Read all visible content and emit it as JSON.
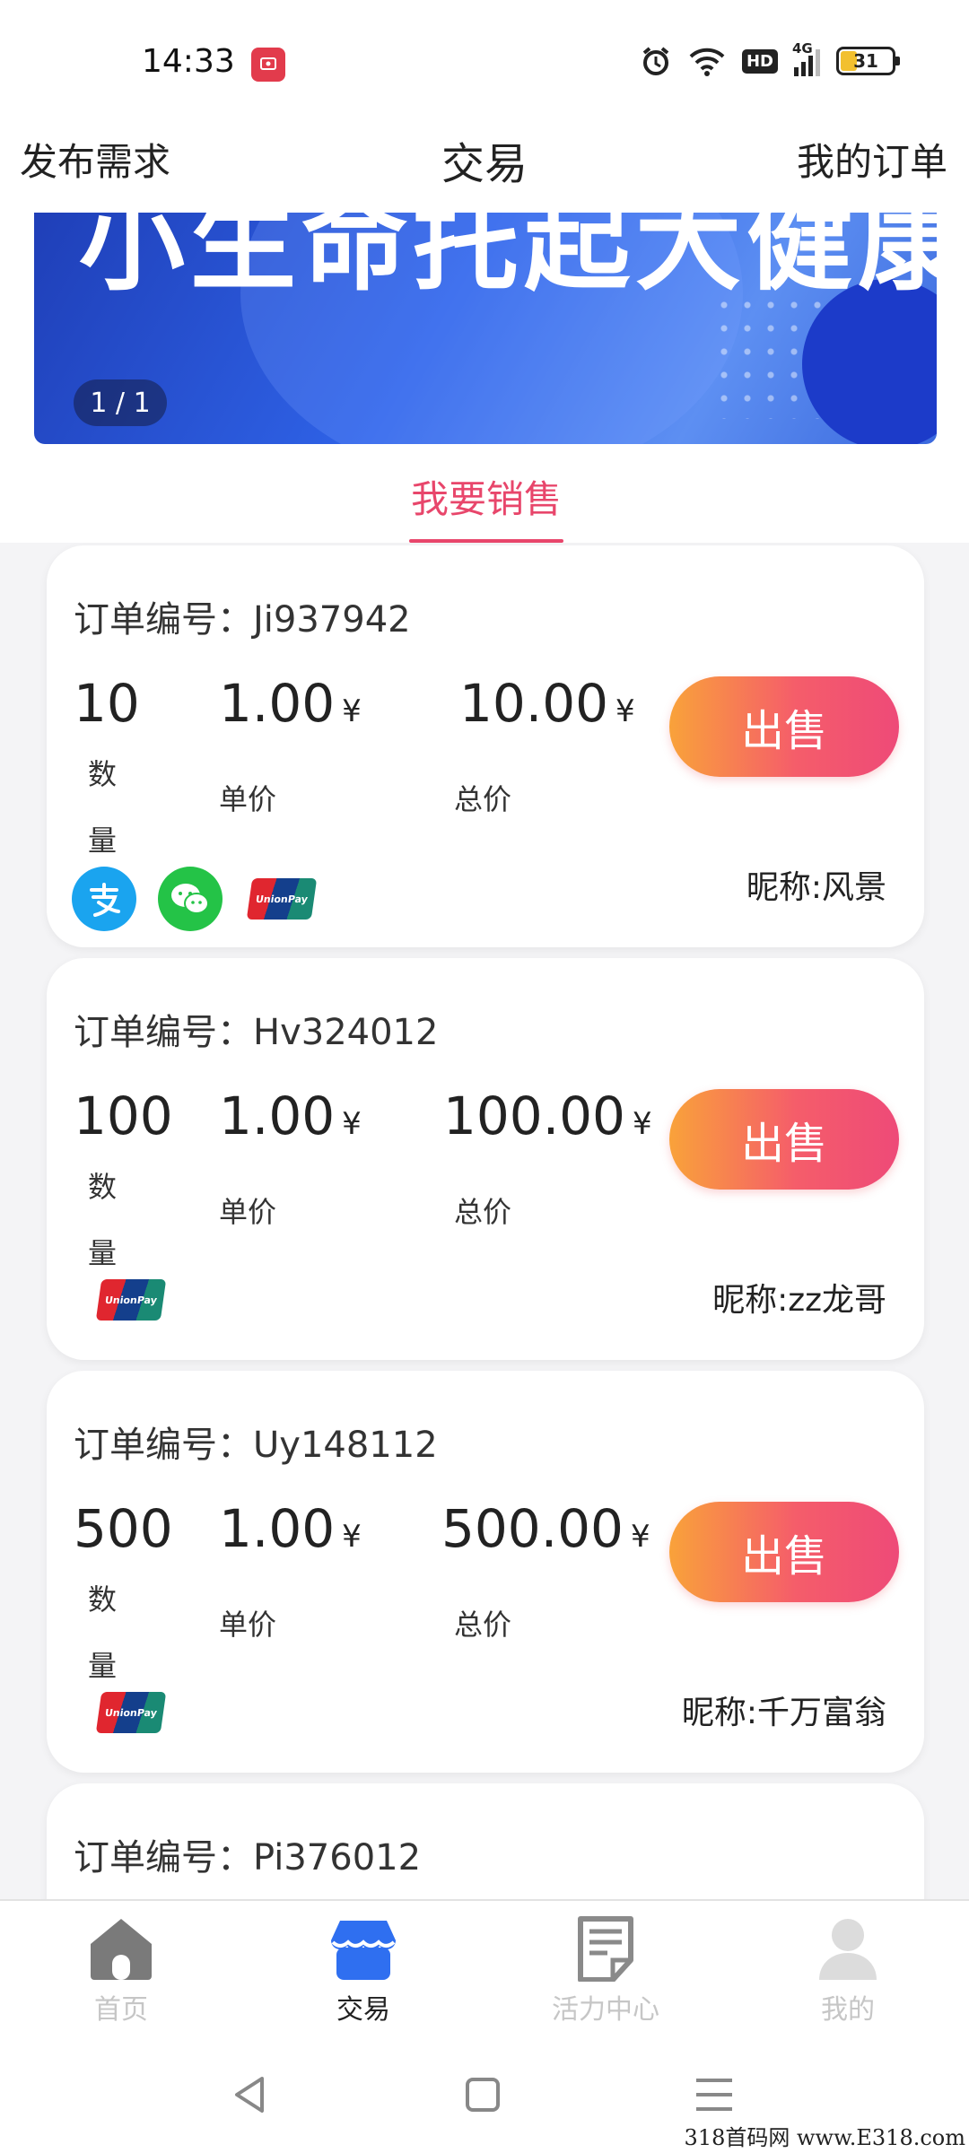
{
  "status_bar": {
    "time": "14:33",
    "battery": "31",
    "network": "4G",
    "hd_label": "HD"
  },
  "header": {
    "left": "发布需求",
    "title": "交易",
    "right": "我的订单"
  },
  "banner": {
    "text": "小生命托起大健康",
    "pager": "1 / 1"
  },
  "tabs": {
    "sell": "我要销售"
  },
  "orders": [
    {
      "order_label": "订单编号：Ji937942",
      "quantity": "10",
      "quantity_label": "数量",
      "unit_price": "1.00",
      "unit_price_label": "单价",
      "total": "10.00",
      "total_label": "总价",
      "currency": "¥",
      "button": "出售",
      "nickname": "昵称:风景",
      "payment_methods": [
        "alipay-icon",
        "wechat-pay-icon",
        "unionpay-icon"
      ]
    },
    {
      "order_label": "订单编号：Hv324012",
      "quantity": "100",
      "quantity_label": "数量",
      "unit_price": "1.00",
      "unit_price_label": "单价",
      "total": "100.00",
      "total_label": "总价",
      "currency": "¥",
      "button": "出售",
      "nickname": "昵称:zz龙哥",
      "payment_methods": [
        "unionpay-icon"
      ]
    },
    {
      "order_label": "订单编号：Uy148112",
      "quantity": "500",
      "quantity_label": "数量",
      "unit_price": "1.00",
      "unit_price_label": "单价",
      "total": "500.00",
      "total_label": "总价",
      "currency": "¥",
      "button": "出售",
      "nickname": "昵称:千万富翁",
      "payment_methods": [
        "unionpay-icon"
      ]
    },
    {
      "order_label": "订单编号：Pi376012"
    }
  ],
  "bottom_nav": [
    {
      "label": "首页",
      "icon": "home-icon",
      "active": false
    },
    {
      "label": "交易",
      "icon": "shop-icon",
      "active": true
    },
    {
      "label": "活力中心",
      "icon": "document-icon",
      "active": false
    },
    {
      "label": "我的",
      "icon": "profile-icon",
      "active": false
    }
  ],
  "watermark": "318首码网  www.E318.com",
  "colors": {
    "accent": "#e8466b",
    "button_gradient_start": "#f9a23a",
    "button_gradient_end": "#ee4a78",
    "nav_active": "#2f6ff0",
    "nav_inactive": "#c6c6c6"
  }
}
